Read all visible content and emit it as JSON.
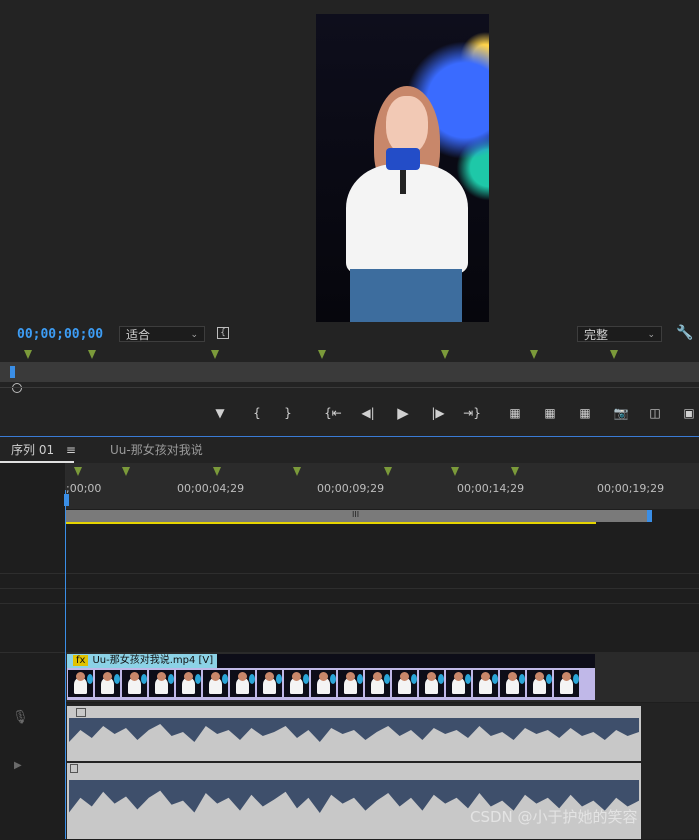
{
  "monitor": {
    "timecode": "00;00;00;00",
    "fit_select": "适合",
    "quality_select": "完整"
  },
  "controls": [
    "marker-add",
    "mark-in",
    "mark-out",
    "go-to-in",
    "step-back",
    "play",
    "step-forward",
    "go-to-out",
    "lift",
    "extract",
    "insert",
    "export-frame",
    "comparison",
    "button-editor"
  ],
  "timeline": {
    "tab_active": "序列 01",
    "tab_other": "Uu-那女孩对我说",
    "ruler_labels": [
      ";00;00",
      "00;00;04;29",
      "00;00;09;29",
      "00;00;14;29",
      "00;00;19;29"
    ],
    "clip_name": "Uu-那女孩对我说.mp4 [V]",
    "fx_badge": "fx",
    "workarea_grip": "III"
  },
  "watermark": "CSDN @小于护她的笑容",
  "colors": {
    "accent": "#3d9df5",
    "marker": "#7b9a3a",
    "workarea_bar": "#e5d400"
  }
}
